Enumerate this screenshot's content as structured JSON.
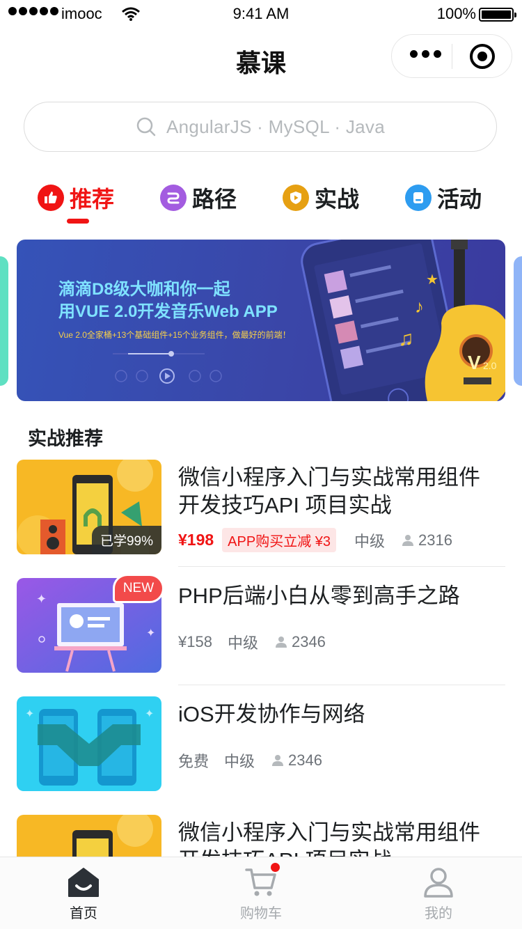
{
  "status_bar": {
    "carrier": "imooc",
    "time": "9:41 AM",
    "battery_text": "100%"
  },
  "nav": {
    "title": "慕课"
  },
  "search": {
    "placeholder": "AngularJS · MySQL · Java"
  },
  "tabs": [
    {
      "label": "推荐",
      "icon": "thumbs-up-icon",
      "color": "#f01414",
      "active": true
    },
    {
      "label": "路径",
      "icon": "path-icon",
      "color": "#a35ce0",
      "active": false
    },
    {
      "label": "实战",
      "icon": "play-shield-icon",
      "color": "#e6a012",
      "active": false
    },
    {
      "label": "活动",
      "icon": "activity-icon",
      "color": "#2d9cf0",
      "active": false
    }
  ],
  "banner": {
    "title_line1": "滴滴D8级大咖和你一起",
    "title_line2": "用VUE 2.0开发音乐Web APP",
    "subtitle": "Vue 2.0全家桶+13个基础组件+15个业务组件，做最好的前端！"
  },
  "section": {
    "title": "实战推荐"
  },
  "courses": [
    {
      "title": "微信小程序入门与实战常用组件开发技巧API  项目实战",
      "learned": "已学99%",
      "price": "¥198",
      "promo": "APP购买立减 ¥3",
      "level": "中级",
      "students": "2316"
    },
    {
      "title": "PHP后端小白从零到高手之路",
      "badge": "NEW",
      "price": "¥158",
      "level": "中级",
      "students": "2346"
    },
    {
      "title": "iOS开发协作与网络",
      "price": "免费",
      "level": "中级",
      "students": "2346"
    },
    {
      "title": "微信小程序入门与实战常用组件开发技巧API  项目实战"
    }
  ],
  "tabbar": [
    {
      "label": "首页",
      "icon": "home-icon",
      "active": true
    },
    {
      "label": "购物车",
      "icon": "cart-icon",
      "active": false,
      "has_dot": true
    },
    {
      "label": "我的",
      "icon": "user-icon",
      "active": false
    }
  ],
  "colors": {
    "accent": "#f01414",
    "text": "#1c1f21",
    "muted": "#6d7278"
  }
}
